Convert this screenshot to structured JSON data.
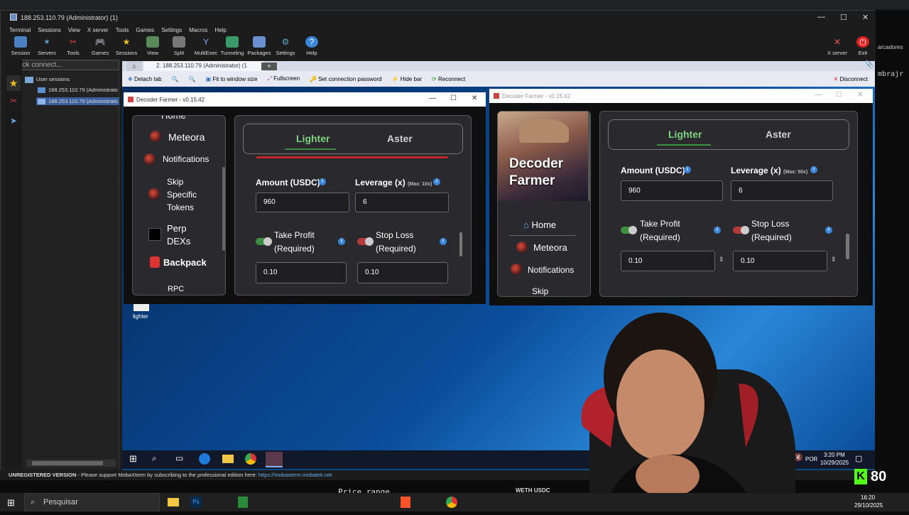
{
  "moba": {
    "title": "188.253.110.79 (Administrator) (1)",
    "menu": [
      "Terminal",
      "Sessions",
      "View",
      "X server",
      "Tools",
      "Games",
      "Settings",
      "Macros",
      "Help"
    ],
    "toolbar": [
      "Session",
      "Servers",
      "Tools",
      "Games",
      "Sessions",
      "View",
      "Split",
      "MultiExec",
      "Tunneling",
      "Packages",
      "Settings",
      "Help"
    ],
    "toolbar_right": [
      "X server",
      "Exit"
    ],
    "quick_connect": "Quick connect...",
    "user_sessions": "User sessions",
    "sessions": [
      "188.253.110.79 (Administrato",
      "188.253.110.79 (Administrato"
    ],
    "remote_tab": "2. 188.253.110.79 (Administrator) (1",
    "remote_toolbar": [
      "Detach tab",
      "Fit to window size",
      "Fullscreen",
      "Set connection password",
      "Hide bar",
      "Reconnect"
    ],
    "disconnect": "Disconnect",
    "status": "UNREGISTERED VERSION",
    "status_msg": "  -  Please support MobaXterm by subscribing to the professional edition here:",
    "status_link": "https://mobaxterm.mobatek.net",
    "right_edge_text": [
      "arcadores",
      "mbrajr"
    ]
  },
  "desktop": {
    "icon_label": "lighter",
    "taskbar_lang": "POR",
    "taskbar_time": "3:20 PM",
    "taskbar_date": "10/29/2025"
  },
  "win1": {
    "title": "Decoder Farmer - v0.15.42",
    "nav": [
      "Home",
      "Meteora",
      "Notifications",
      "Skip Specific Tokens",
      "Perp DEXs",
      "Backpack",
      "RPC"
    ],
    "tabs": [
      "Lighter",
      "Aster"
    ],
    "amount_label": "Amount (USDC)",
    "leverage_label": "Leverage (x)",
    "leverage_max": "(Max: 10x)",
    "amount_value": "960",
    "leverage_value": "6",
    "tp_label": "Take Profit (Required)",
    "sl_label": "Stop Loss (Required)",
    "tp_value": "0.10",
    "sl_value": "0.10"
  },
  "win2": {
    "title": "Decoder Farmer - v0.15.42",
    "brand": "Decoder Farmer",
    "nav": [
      "Home",
      "Meteora",
      "Notifications",
      "Skip"
    ],
    "tabs": [
      "Lighter",
      "Aster"
    ],
    "amount_label": "Amount (USDC)",
    "leverage_label": "Leverage (x)",
    "leverage_max": "(Max: 50x)",
    "amount_value": "960",
    "leverage_value": "6",
    "tp_label": "Take Profit (Required)",
    "sl_label": "Stop Loss (Required)",
    "tp_value": "0.10",
    "sl_value": "0.10"
  },
  "host": {
    "search": "Pesquisar",
    "time": "16:20",
    "date": "29/10/2025",
    "behind_text": "Price range",
    "behind_text2": "WETH   USDC",
    "kick_count": "80"
  },
  "colors": {
    "accent_green": "#3e8e41",
    "moba_bar": "#1c1c1c",
    "desktop_blue": "#0a4d9a"
  }
}
